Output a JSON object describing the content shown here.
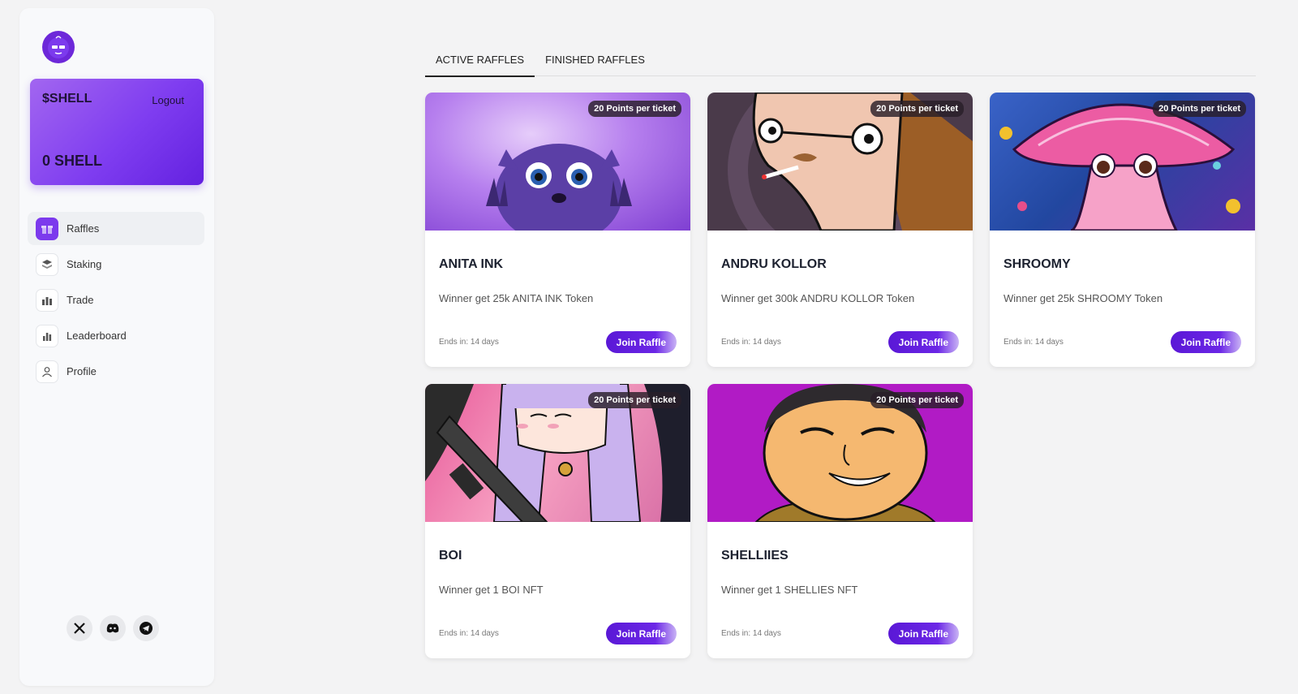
{
  "sidebar": {
    "balance": {
      "title": "$SHELL",
      "logout_label": "Logout",
      "value": "0 SHELL"
    },
    "nav": [
      {
        "label": "Raffles",
        "icon": "gift-icon",
        "active": true
      },
      {
        "label": "Staking",
        "icon": "stack-icon",
        "active": false
      },
      {
        "label": "Trade",
        "icon": "chart-icon",
        "active": false
      },
      {
        "label": "Leaderboard",
        "icon": "bar-chart-icon",
        "active": false
      },
      {
        "label": "Profile",
        "icon": "user-icon",
        "active": false
      }
    ],
    "socials": [
      "x-icon",
      "discord-icon",
      "telegram-icon"
    ]
  },
  "tabs": [
    {
      "label": "ACTIVE RAFFLES",
      "active": true
    },
    {
      "label": "FINISHED RAFFLES",
      "active": false
    }
  ],
  "raffles": [
    {
      "title": "ANITA INK",
      "badge": "20 Points per ticket",
      "description": "Winner get 25k ANITA INK Token",
      "ends": "Ends in: 14 days",
      "button": "Join Raffle"
    },
    {
      "title": "ANDRU KOLLOR",
      "badge": "20 Points per ticket",
      "description": "Winner get 300k ANDRU KOLLOR Token",
      "ends": "Ends in: 14 days",
      "button": "Join Raffle"
    },
    {
      "title": "SHROOMY",
      "badge": "20 Points per ticket",
      "description": "Winner get 25k SHROOMY Token",
      "ends": "Ends in: 14 days",
      "button": "Join Raffle"
    },
    {
      "title": "BOI",
      "badge": "20 Points per ticket",
      "description": "Winner get 1 BOI NFT",
      "ends": "Ends in: 14 days",
      "button": "Join Raffle"
    },
    {
      "title": "SHELLIIES",
      "badge": "20 Points per ticket",
      "description": "Winner get 1 SHELLIES NFT",
      "ends": "Ends in: 14 days",
      "button": "Join Raffle"
    }
  ],
  "colors": {
    "accent": "#6321e0",
    "background": "#f3f3f4",
    "sidebar": "#f8f9fb"
  }
}
